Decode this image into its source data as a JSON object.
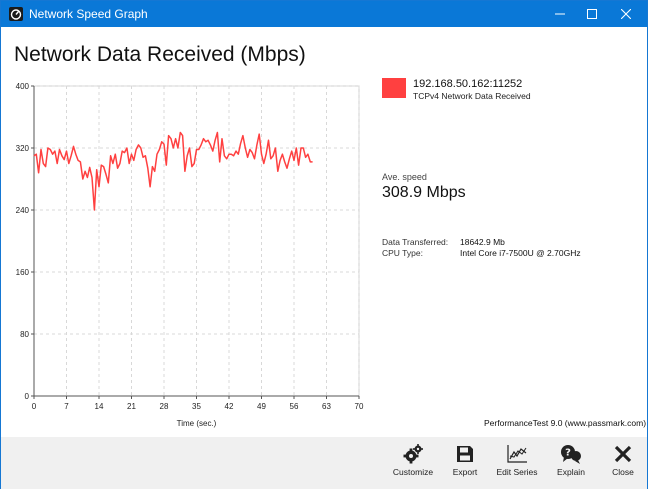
{
  "window": {
    "title": "Network Speed Graph"
  },
  "heading": "Network Data Received (Mbps)",
  "legend": {
    "source": "192.168.50.162:11252",
    "description": "TCPv4 Network Data Received",
    "color": "#ff4040"
  },
  "stats": {
    "ave_label": "Ave. speed",
    "ave_value": "308.9 Mbps",
    "transferred_label": "Data Transferred:",
    "transferred_value": "18642.9 Mb",
    "cpu_label": "CPU Type:",
    "cpu_value": "Intel Core i7-7500U @ 2.70GHz"
  },
  "credit": "PerformanceTest 9.0 (www.passmark.com)",
  "toolbar": {
    "customize": "Customize",
    "export": "Export",
    "edit_series": "Edit Series",
    "explain": "Explain",
    "close": "Close"
  },
  "chart_data": {
    "type": "line",
    "xlabel": "Time (sec.)",
    "ylabel": "",
    "xlim": [
      0,
      70
    ],
    "ylim": [
      0,
      400
    ],
    "xticks": [
      0,
      7,
      14,
      21,
      28,
      35,
      42,
      49,
      56,
      63,
      70
    ],
    "yticks": [
      0,
      80,
      160,
      240,
      320,
      400
    ],
    "grid": true,
    "series": [
      {
        "name": "192.168.50.162:11252",
        "color": "#ff4040",
        "x": [
          0,
          0.5,
          1,
          1.5,
          2,
          2.5,
          3,
          3.5,
          4,
          4.5,
          5,
          5.5,
          6,
          6.5,
          7,
          7.5,
          8,
          8.5,
          9,
          9.5,
          10,
          10.5,
          11,
          11.5,
          12,
          12.5,
          13,
          13.5,
          14,
          14.5,
          15,
          15.5,
          16,
          16.5,
          17,
          17.5,
          18,
          18.5,
          19,
          19.5,
          20,
          20.5,
          21,
          21.5,
          22,
          22.5,
          23,
          23.5,
          24,
          24.5,
          25,
          25.5,
          26,
          26.5,
          27,
          27.5,
          28,
          28.5,
          29,
          29.5,
          30,
          30.5,
          31,
          31.5,
          32,
          32.5,
          33,
          33.5,
          34,
          34.5,
          35,
          35.5,
          36,
          36.5,
          37,
          37.5,
          38,
          38.5,
          39,
          39.5,
          40,
          40.5,
          41,
          41.5,
          42,
          42.5,
          43,
          43.5,
          44,
          44.5,
          45,
          45.5,
          46,
          46.5,
          47,
          47.5,
          48,
          48.5,
          49,
          49.5,
          50,
          50.5,
          51,
          51.5,
          52,
          52.5,
          53,
          53.5,
          54,
          54.5,
          55,
          55.5,
          56,
          56.5,
          57,
          57.5,
          58,
          58.5,
          59,
          59.5,
          60
        ],
        "values": [
          310,
          312,
          288,
          318,
          300,
          296,
          320,
          318,
          312,
          316,
          300,
          318,
          310,
          305,
          316,
          300,
          310,
          322,
          312,
          304,
          302,
          280,
          290,
          282,
          295,
          282,
          240,
          292,
          270,
          298,
          296,
          286,
          275,
          310,
          300,
          312,
          294,
          300,
          316,
          314,
          320,
          300,
          312,
          304,
          318,
          324,
          320,
          308,
          310,
          294,
          270,
          296,
          290,
          312,
          318,
          328,
          325,
          298,
          336,
          332,
          320,
          332,
          320,
          340,
          336,
          290,
          310,
          320,
          296,
          300,
          318,
          318,
          324,
          332,
          328,
          330,
          324,
          316,
          330,
          340,
          302,
          332,
          310,
          306,
          312,
          312,
          310,
          316,
          312,
          326,
          336,
          320,
          308,
          318,
          314,
          306,
          324,
          338,
          312,
          300,
          312,
          330,
          306,
          310,
          320,
          290,
          304,
          312,
          302,
          294,
          306,
          316,
          304,
          320,
          298,
          320,
          320,
          308,
          312,
          302,
          302
        ]
      }
    ]
  }
}
